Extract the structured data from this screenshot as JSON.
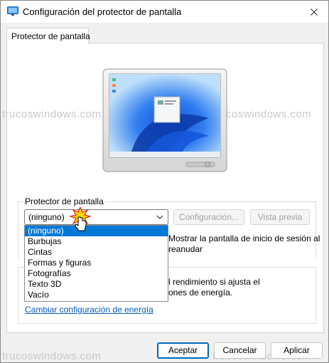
{
  "window": {
    "title": "Configuración del protector de pantalla"
  },
  "tabs": [
    {
      "label": "Protector de pantalla"
    }
  ],
  "watermark": "trucoswindows.com",
  "screensaver": {
    "group_label": "Protector de pantalla",
    "selected": "(ninguno)",
    "settings_button": "Configuración...",
    "preview_button": "Vista previa",
    "resume_line1": "Mostrar la pantalla de inicio de sesión al",
    "resume_line2": "reanudar",
    "options": [
      "(ninguno)",
      "Burbujas",
      "Cintas",
      "Formas y figuras",
      "Fotografías",
      "Texto 3D",
      "Vacío"
    ]
  },
  "power": {
    "text_line1": "l rendimiento si ajusta el",
    "text_line2": "ones de energía.",
    "link": "Cambiar configuración de energía"
  },
  "buttons": {
    "ok": "Aceptar",
    "cancel": "Cancelar",
    "apply": "Aplicar"
  },
  "colors": {
    "accent": "#0078d7",
    "link": "#0a5ab8"
  }
}
